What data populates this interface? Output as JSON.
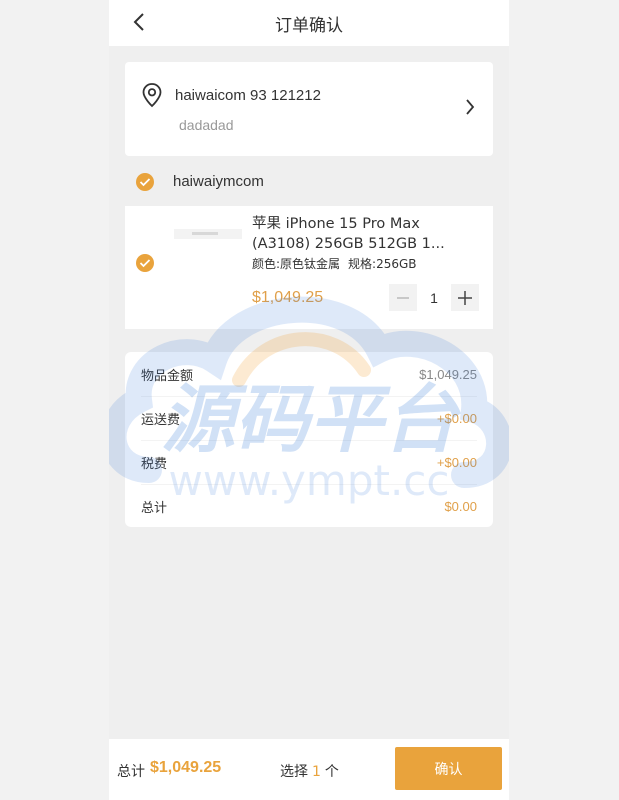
{
  "header": {
    "title": "订单确认"
  },
  "address": {
    "line1": "haiwaicom 93 121212",
    "line2": "dadadad"
  },
  "shop": {
    "name": "haiwaiymcom",
    "checked": true
  },
  "product": {
    "name_line1": "苹果 iPhone 15 Pro Max",
    "name_line2": "(A3108) 256GB 512GB 1...",
    "spec_color": "颜色:原色钛金属",
    "spec_size": "规格:256GB",
    "price": "$1,049.25",
    "quantity": "1",
    "checked": true
  },
  "summary": {
    "rows": [
      {
        "label": "物品金额",
        "value": "$1,049.25"
      },
      {
        "label": "运送费",
        "value": "+$0.00"
      },
      {
        "label": "税费",
        "value": "+$0.00"
      },
      {
        "label": "总计",
        "value": "$0.00"
      }
    ]
  },
  "watermark": {
    "brand": "源码平台",
    "url": "www.ympt.cc"
  },
  "footer": {
    "total_label": "总计",
    "total_amount": "$1,049.25",
    "select_prefix": "选择",
    "select_count": "1",
    "select_suffix": "个",
    "confirm_label": "确认"
  },
  "colors": {
    "accent": "#e9a33c",
    "price": "#e0a04a",
    "background": "#efefef"
  },
  "icons": [
    "back-arrow-icon",
    "location-pin-icon",
    "chevron-right-icon",
    "check-icon",
    "minus-icon",
    "plus-icon"
  ]
}
